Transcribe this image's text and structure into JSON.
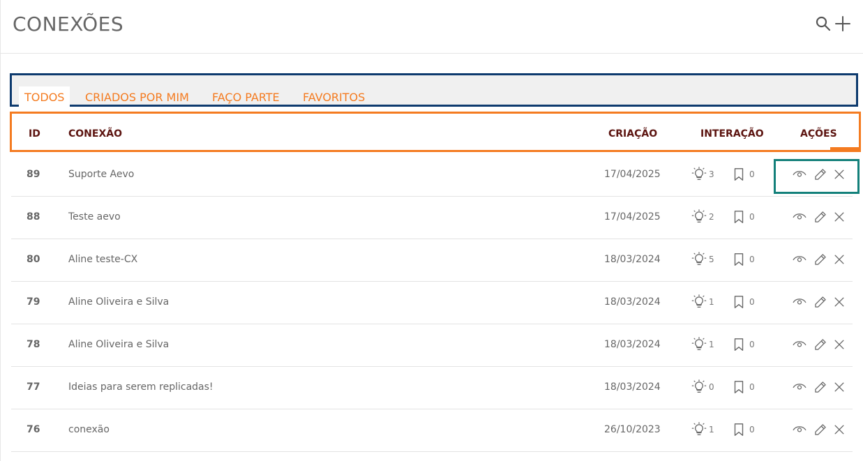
{
  "page": {
    "title": "CONEXÕES"
  },
  "header_icons": {
    "search": "search-icon",
    "add": "plus-icon"
  },
  "tabs": [
    {
      "label": "TODOS",
      "active": true
    },
    {
      "label": "CRIADOS POR MIM",
      "active": false
    },
    {
      "label": "FAÇO PARTE",
      "active": false
    },
    {
      "label": "FAVORITOS",
      "active": false
    }
  ],
  "columns": {
    "id": "ID",
    "connection": "CONEXÃO",
    "created": "CRIAÇÃO",
    "interaction": "INTERAÇÃO",
    "actions": "AÇÕES"
  },
  "row_icons": {
    "ideas": "lightbulb-icon",
    "saved": "bookmark-icon",
    "view": "eye-icon",
    "edit": "pencil-icon",
    "delete": "close-icon"
  },
  "rows": [
    {
      "id": "89",
      "name": "Suporte Aevo",
      "date": "17/04/2025",
      "ideas": "3",
      "saved": "0"
    },
    {
      "id": "88",
      "name": "Teste aevo",
      "date": "17/04/2025",
      "ideas": "2",
      "saved": "0"
    },
    {
      "id": "80",
      "name": "Aline teste-CX",
      "date": "18/03/2024",
      "ideas": "5",
      "saved": "0"
    },
    {
      "id": "79",
      "name": "Aline Oliveira e Silva",
      "date": "18/03/2024",
      "ideas": "1",
      "saved": "0"
    },
    {
      "id": "78",
      "name": "Aline Oliveira e Silva",
      "date": "18/03/2024",
      "ideas": "1",
      "saved": "0"
    },
    {
      "id": "77",
      "name": "Ideias para serem replicadas!",
      "date": "18/03/2024",
      "ideas": "0",
      "saved": "0"
    },
    {
      "id": "76",
      "name": "conexão",
      "date": "26/10/2023",
      "ideas": "1",
      "saved": "0"
    }
  ],
  "colors": {
    "accent": "#f47b20",
    "header_text": "#5c1410",
    "tabs_outline": "#0d3a6e",
    "actions_outline": "#13807a"
  }
}
